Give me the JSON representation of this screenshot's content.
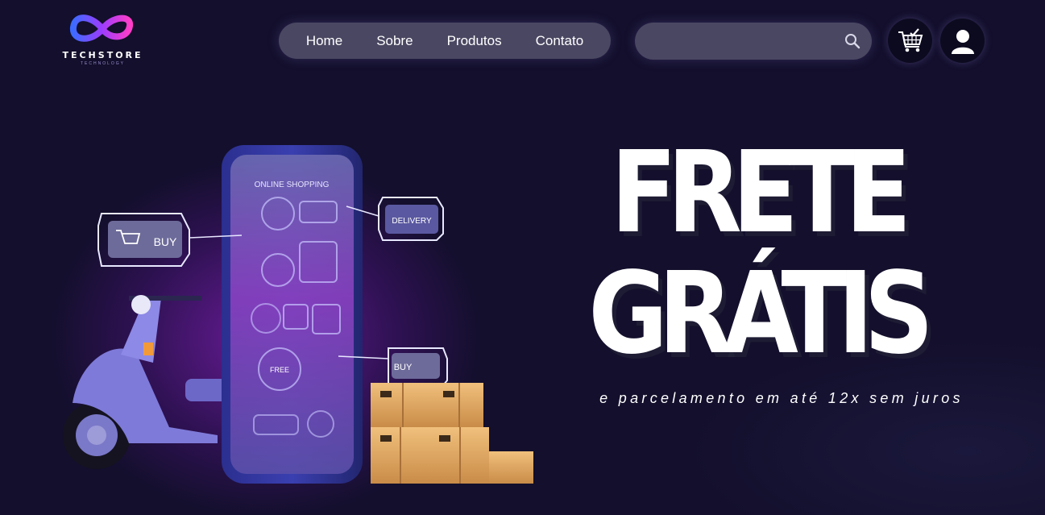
{
  "brand": {
    "name": "TECHSTORE",
    "tagline": "TECHNOLOGY"
  },
  "nav": {
    "items": [
      "Home",
      "Sobre",
      "Produtos",
      "Contato"
    ]
  },
  "search": {
    "placeholder": "",
    "value": ""
  },
  "header_icons": {
    "cart": "shopping-cart-check-icon",
    "user": "user-icon",
    "search": "magnifier-icon"
  },
  "hero": {
    "headline_line1": "FRETE",
    "headline_line2": "GRÁTIS",
    "subline": "e parcelamento em até 12x sem juros",
    "illustration_labels": {
      "screen_title": "ONLINE SHOPPING",
      "badge_buy": "BUY",
      "badge_delivery": "DELIVERY",
      "badge_buy_small": "BUY",
      "truck_label": "FREE"
    }
  },
  "colors": {
    "background": "#130f2c",
    "pill": "#4a4762",
    "accent_purple": "#8b5cf6",
    "accent_pink": "#e040fb",
    "box": "#d9a05b",
    "scooter": "#7e7ad9"
  }
}
